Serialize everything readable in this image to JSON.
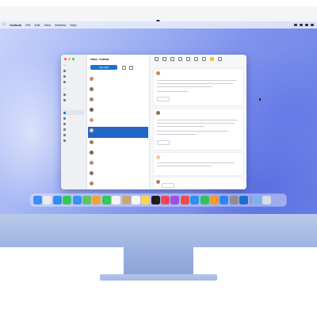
{
  "menubar": {
    "items": [
      "Outlook",
      "File",
      "Edit",
      "View",
      "Window",
      "Help"
    ]
  },
  "window": {
    "title": "Outlook",
    "account": "Inbox • Outlook",
    "new_mail_label": "New Mail",
    "thread_title": "Thread"
  },
  "dock": {
    "apps": [
      {
        "icon": "finder-icon",
        "color": "#3d8ef7"
      },
      {
        "icon": "launchpad-icon",
        "color": "#e9e9f0"
      },
      {
        "icon": "safari-icon",
        "color": "#2f8df5"
      },
      {
        "icon": "messages-icon",
        "color": "#33c95a"
      },
      {
        "icon": "mail-icon",
        "color": "#3c8ff6"
      },
      {
        "icon": "maps-icon",
        "color": "#5cc46b"
      },
      {
        "icon": "photos-icon",
        "color": "#f0a03c"
      },
      {
        "icon": "facetime-icon",
        "color": "#35c758"
      },
      {
        "icon": "calendar-icon",
        "color": "#f4f4f4"
      },
      {
        "icon": "contacts-icon",
        "color": "#c9a57e"
      },
      {
        "icon": "reminders-icon",
        "color": "#f7f7f7"
      },
      {
        "icon": "notes-icon",
        "color": "#f7d452"
      },
      {
        "icon": "tv-icon",
        "color": "#1d1d1f"
      },
      {
        "icon": "music-icon",
        "color": "#f2445b"
      },
      {
        "icon": "podcasts-icon",
        "color": "#9b52e0"
      },
      {
        "icon": "news-icon",
        "color": "#f24b4b"
      },
      {
        "icon": "keynote-icon",
        "color": "#2f8ff3"
      },
      {
        "icon": "numbers-icon",
        "color": "#33c15a"
      },
      {
        "icon": "pages-icon",
        "color": "#f59a34"
      },
      {
        "icon": "app-store-icon",
        "color": "#2d86f5"
      },
      {
        "icon": "settings-icon",
        "color": "#8e8e93"
      },
      {
        "icon": "outlook-icon",
        "color": "#1a6fd1"
      }
    ],
    "trailing": [
      {
        "icon": "downloads-folder-icon",
        "color": "#7fb1ef"
      },
      {
        "icon": "trash-icon",
        "color": "#d7dbe3"
      }
    ]
  },
  "colors": {
    "accent": "#1a73c9",
    "selected_message": "#2167c5"
  }
}
